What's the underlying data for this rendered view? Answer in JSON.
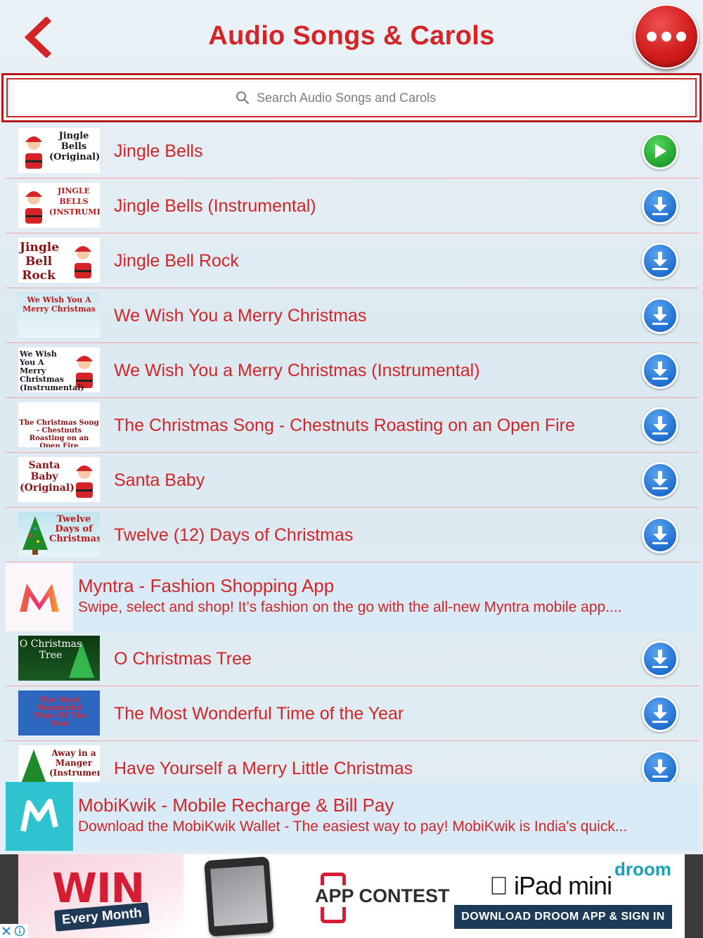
{
  "header": {
    "title": "Audio Songs & Carols",
    "back_icon": "chevron-left-icon",
    "more_icon": "ellipsis-icon",
    "accent_color": "#d42427"
  },
  "search": {
    "placeholder": "Search Audio Songs and Carols"
  },
  "songs": [
    {
      "title": "Jingle Bells",
      "thumb": "Jingle Bells (Original)",
      "action": "play"
    },
    {
      "title": "Jingle Bells (Instrumental)",
      "thumb": "JINGLE BELLS (INSTRUMENTAL)",
      "action": "download"
    },
    {
      "title": "Jingle Bell Rock",
      "thumb": "Jingle Bell Rock",
      "action": "download"
    },
    {
      "title": "We Wish You a Merry Christmas",
      "thumb": "We Wish You A Merry Christmas",
      "action": "download"
    },
    {
      "title": "We Wish You a Merry Christmas (Instrumental)",
      "thumb": "We Wish You A Merry Christmas (Instrumental)",
      "action": "download"
    },
    {
      "title": "The Christmas Song - Chestnuts Roasting on an Open Fire",
      "thumb": "The Christmas Song - Chestnuts Roasting on an Open Fire",
      "action": "download"
    },
    {
      "title": "Santa Baby",
      "thumb": "Santa Baby (Original)",
      "action": "download"
    },
    {
      "title": "Twelve (12) Days of Christmas",
      "thumb": "Twelve Days of Christmas",
      "action": "download"
    },
    {
      "title": "O Christmas Tree",
      "thumb": "O Christmas Tree",
      "action": "download"
    },
    {
      "title": "The Most Wonderful Time of the Year",
      "thumb": "The Most Wonderful Time Of The Year",
      "action": "download"
    },
    {
      "title": "Have Yourself a Merry Little Christmas",
      "thumb": "Away in a Manger (Instrumental)",
      "action": "download"
    }
  ],
  "ads": [
    {
      "title": "Myntra - Fashion Shopping App",
      "description": "Swipe, select and shop! It’s fashion on the go with the all-new Myntra mobile app....",
      "icon": "myntra-logo-icon"
    },
    {
      "title": "MobiKwik - Mobile Recharge & Bill Pay",
      "description": "Download the MobiKwik Wallet - The easiest way to pay! MobiKwik is India's quick...",
      "icon": "mobikwik-logo-icon"
    }
  ],
  "banner": {
    "win": "WIN",
    "every_month": "Every Month",
    "contest": "APP CONTEST",
    "product": "iPad mini",
    "brand": "droom",
    "cta": "DOWNLOAD DROOM APP & SIGN IN"
  }
}
